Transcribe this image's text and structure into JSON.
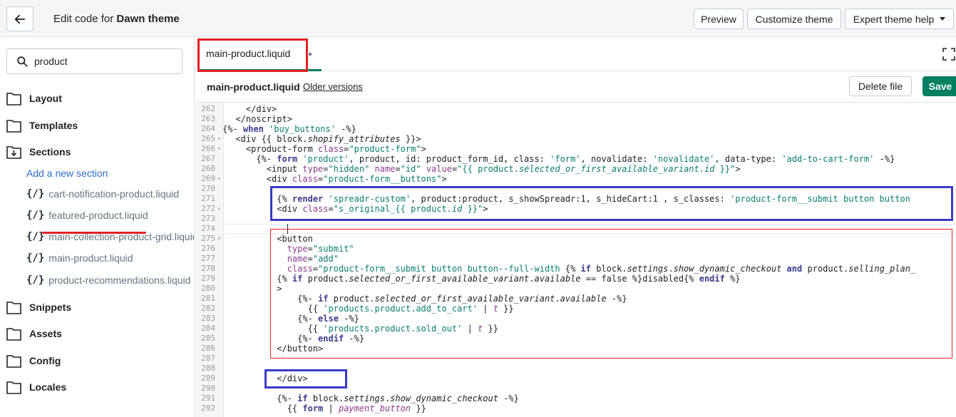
{
  "topbar": {
    "title_prefix": "Edit code for ",
    "title_theme": "Dawn theme",
    "preview_label": "Preview",
    "customize_label": "Customize theme",
    "help_label": "Expert theme help"
  },
  "sidebar": {
    "search_value": "product",
    "folders": [
      "Layout",
      "Templates",
      "Sections",
      "Snippets",
      "Assets",
      "Config",
      "Locales"
    ],
    "add_section": "Add a new section",
    "files": [
      "cart-notification-product.liquid",
      "featured-product.liquid",
      "main-collection-product-grid.liquid",
      "main-product.liquid",
      "product-recommendations.liquid"
    ],
    "code_icon_text": "{/}"
  },
  "tab": {
    "label": "main-product.liquid"
  },
  "filehead": {
    "filename": "main-product.liquid",
    "older_versions": "Older versions",
    "delete_label": "Delete file",
    "save_label": "Save"
  },
  "editor": {
    "line_numbers": [
      "262",
      "263",
      "264",
      "265",
      "266",
      "267",
      "268",
      "269",
      "270",
      "271",
      "272",
      "273",
      "274",
      "275",
      "276",
      "277",
      "278",
      "279",
      "280",
      "281",
      "282",
      "283",
      "284",
      "285",
      "286",
      "287",
      "288",
      "289",
      "290",
      "291",
      "292"
    ]
  },
  "colors": {
    "accent_green": "#008060",
    "highlight_red": "#e32020",
    "highlight_blue": "#3a3ac9",
    "link_blue": "#2c6ecb"
  }
}
